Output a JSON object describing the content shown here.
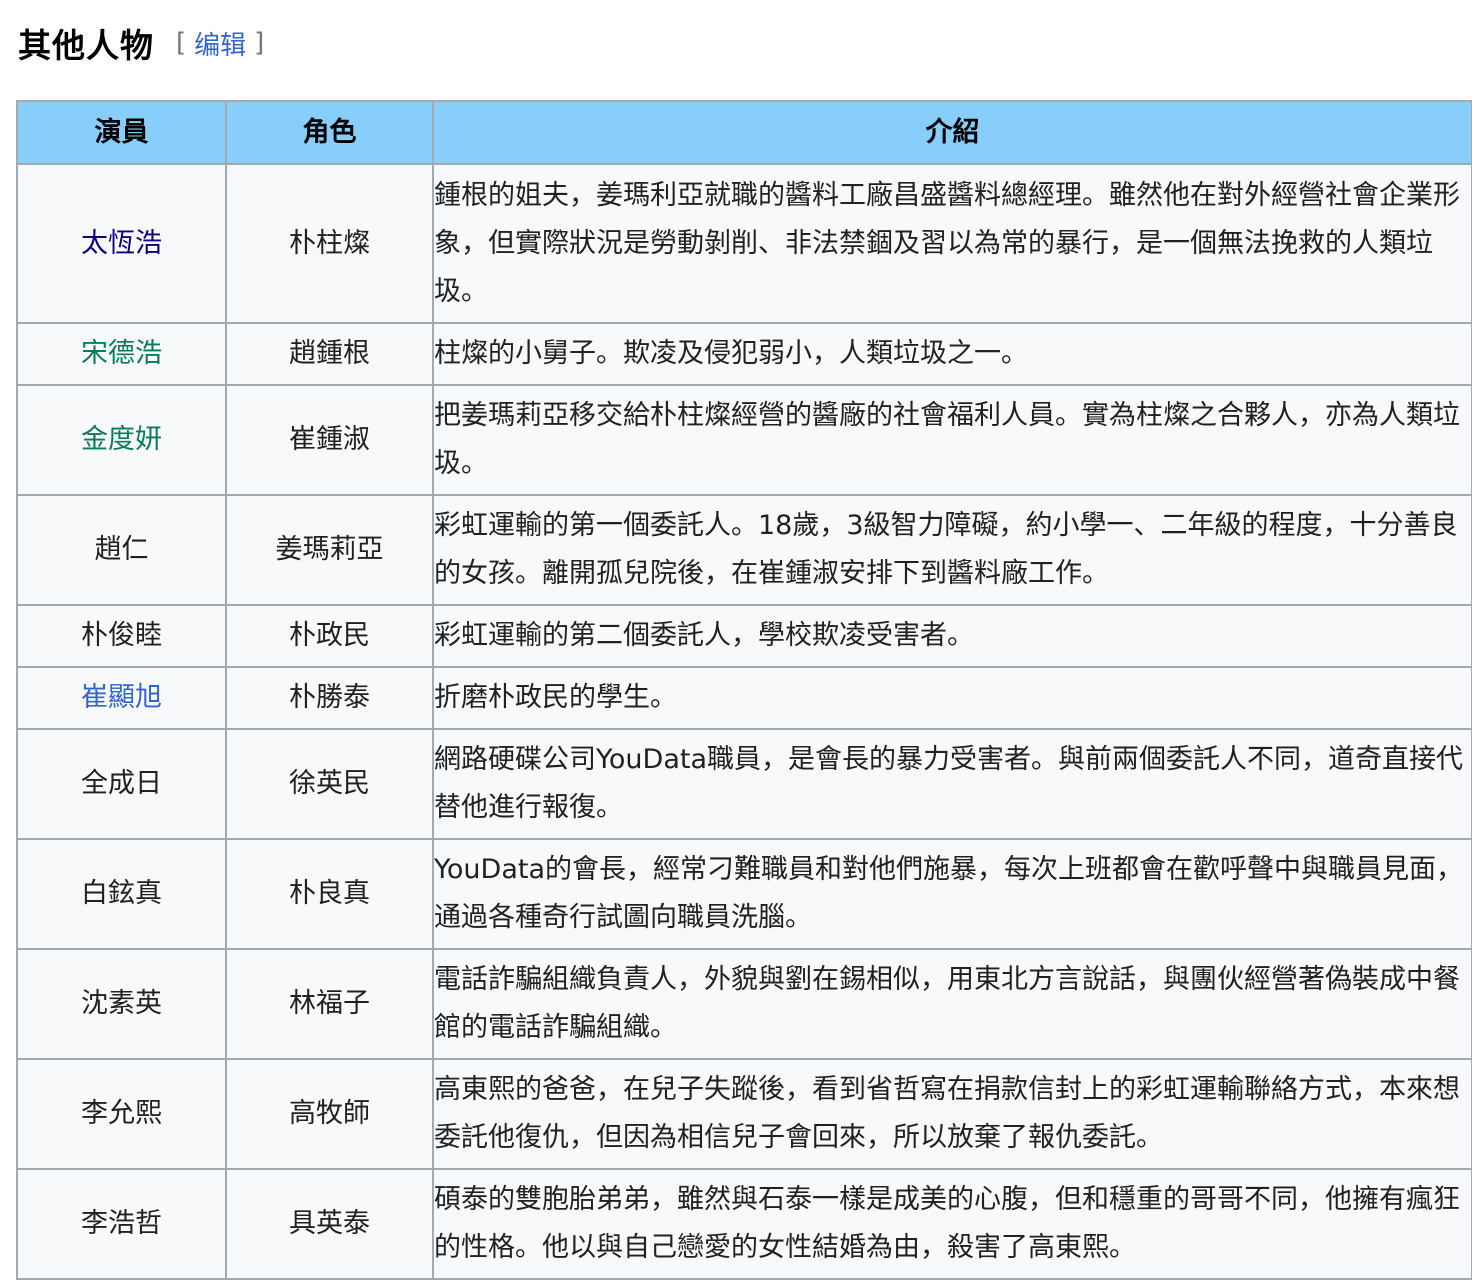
{
  "section": {
    "title": "其他人物",
    "edit_open": "[",
    "edit_label": "编辑",
    "edit_close": "]"
  },
  "table": {
    "headers": {
      "actor": "演員",
      "role": "角色",
      "intro": "介紹"
    },
    "rows": [
      {
        "actor": "太恆浩",
        "role": "朴柱燦",
        "intro": "鍾根的姐夫，姜瑪利亞就職的醬料工廠昌盛醬料總經理。雖然他在對外經營社會企業形象，但實際狀況是勞動剝削、非法禁錮及習以為常的暴行，是一個無法挽救的人類垃圾。"
      },
      {
        "actor": "宋德浩",
        "role": "趙鍾根",
        "intro": "柱燦的小舅子。欺凌及侵犯弱小，人類垃圾之一。"
      },
      {
        "actor": "金度妍",
        "role": "崔鍾淑",
        "intro": "把姜瑪莉亞移交給朴柱燦經營的醬廠的社會福利人員。實為柱燦之合夥人，亦為人類垃圾。"
      },
      {
        "actor": "趙仁",
        "role": "姜瑪莉亞",
        "intro": "彩虹運輸的第一個委託人。18歲，3級智力障礙，約小學一、二年級的程度，十分善良的女孩。離開孤兒院後，在崔鍾淑安排下到醬料廠工作。"
      },
      {
        "actor": "朴俊睦",
        "role": "朴政民",
        "intro": "彩虹運輸的第二個委託人，學校欺凌受害者。"
      },
      {
        "actor": "崔顯旭",
        "role": "朴勝泰",
        "intro": "折磨朴政民的學生。"
      },
      {
        "actor": "全成日",
        "role": "徐英民",
        "intro": "網路硬碟公司YouData職員，是會長的暴力受害者。與前兩個委託人不同，道奇直接代替他進行報復。"
      },
      {
        "actor": "白鉉真",
        "role": "朴良真",
        "intro": "YouData的會長，經常刁難職員和對他們施暴，每次上班都會在歡呼聲中與職員見面，通過各種奇行試圖向職員洗腦。"
      },
      {
        "actor": "沈素英",
        "role": "林福子",
        "intro": "電話詐騙組織負責人，外貌與劉在錫相似，用東北方言說話，與團伙經營著偽裝成中餐館的電話詐騙組織。"
      },
      {
        "actor": "李允熙",
        "role": "高牧師",
        "intro": "高東熙的爸爸，在兒子失蹤後，看到省哲寫在捐款信封上的彩虹運輸聯絡方式，本來想委託他復仇，但因為相信兒子會回來，所以放棄了報仇委託。"
      },
      {
        "actor": "李浩哲",
        "role": "具英泰",
        "intro": "碩泰的雙胞胎弟弟，雖然與石泰一樣是成美的心腹，但和穩重的哥哥不同，他擁有瘋狂的性格。他以與自己戀愛的女性結婚為由，殺害了高東熙。"
      }
    ],
    "link_colors": {
      "visited": "#0b0080",
      "green": "#0b7a5a",
      "link": "#3366cc"
    }
  }
}
